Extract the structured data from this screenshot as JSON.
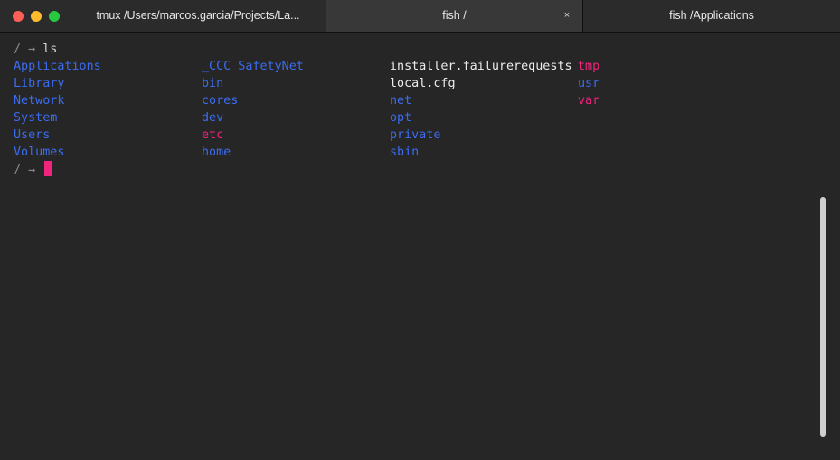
{
  "window": {
    "tabs": [
      {
        "label": "tmux /Users/marcos.garcia/Projects/La..."
      },
      {
        "label": "fish /",
        "close_glyph": "×"
      },
      {
        "label": "fish /Applications"
      }
    ],
    "colors": {
      "dir": "#3b6cf0",
      "sticky_dir": "#f0237d",
      "file": "#ececec",
      "cursor": "#f0237d"
    }
  },
  "terminal": {
    "prompt_path": "/",
    "prompt_arrow": "→",
    "command": "ls",
    "listing": {
      "col0": [
        "Applications",
        "Library",
        "Network",
        "System",
        "Users",
        "Volumes"
      ],
      "col1": [
        "_CCC SafetyNet",
        "bin",
        "cores",
        "dev",
        "etc",
        "home"
      ],
      "col2": [
        "installer.failurerequests",
        "local.cfg",
        "net",
        "opt",
        "private",
        "sbin"
      ],
      "col3": [
        "tmp",
        "usr",
        "var"
      ]
    }
  }
}
